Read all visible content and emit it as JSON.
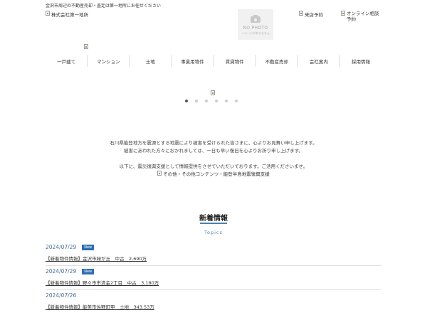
{
  "header": {
    "tagline": "金沢市周辺の不動産売却・査定は第一地所にお任せください",
    "logo_alt": "株式会社第一地所",
    "reserve_alt": "来店予約",
    "online_alt_line1": "オンライン相談",
    "online_alt_line2": "予約",
    "nophoto_text": "NO PHOTO",
    "nophoto_subtext": "イメージがありません"
  },
  "nav": {
    "items": [
      "一戸建て",
      "マンション",
      "土地",
      "事業用物件",
      "賃貸物件",
      "不動産売却",
      "会社案内",
      "採用情報"
    ]
  },
  "slider": {
    "dot_count": 6,
    "active_index": 0
  },
  "notice": {
    "line1": "石川県能登地方を震源とする地震により被害を受けられた皆さまに、心よりお見舞い申し上げます。",
    "line2": "被害にあわれた方々におかれましては、一日も早い復旧を心よりお祈り申し上げます。",
    "line3": "以下に、震災復興支援として情報提供をさせていただいております。ご活用くださいませ。",
    "link_alt": "その他・その他コンテンツ・能登半島地震復興支援"
  },
  "news": {
    "title": "新着情報",
    "subtitle": "Topics",
    "items": [
      {
        "date": "2024/07/29",
        "badge": "New",
        "title": "【新着物件情報】金沢市緑が丘　中古　2,690万"
      },
      {
        "date": "2024/07/29",
        "badge": "New",
        "title": "【新着物件情報】野々市市清金2丁目　中古　3,180万"
      },
      {
        "date": "2024/07/26",
        "badge": "",
        "title": "【新着物件情報】能美市佐野町甲　土地　343.53万"
      }
    ]
  },
  "colors": {
    "accent": "#4a82b0",
    "badge": "#2f6db4",
    "date": "#4a6e9a"
  }
}
